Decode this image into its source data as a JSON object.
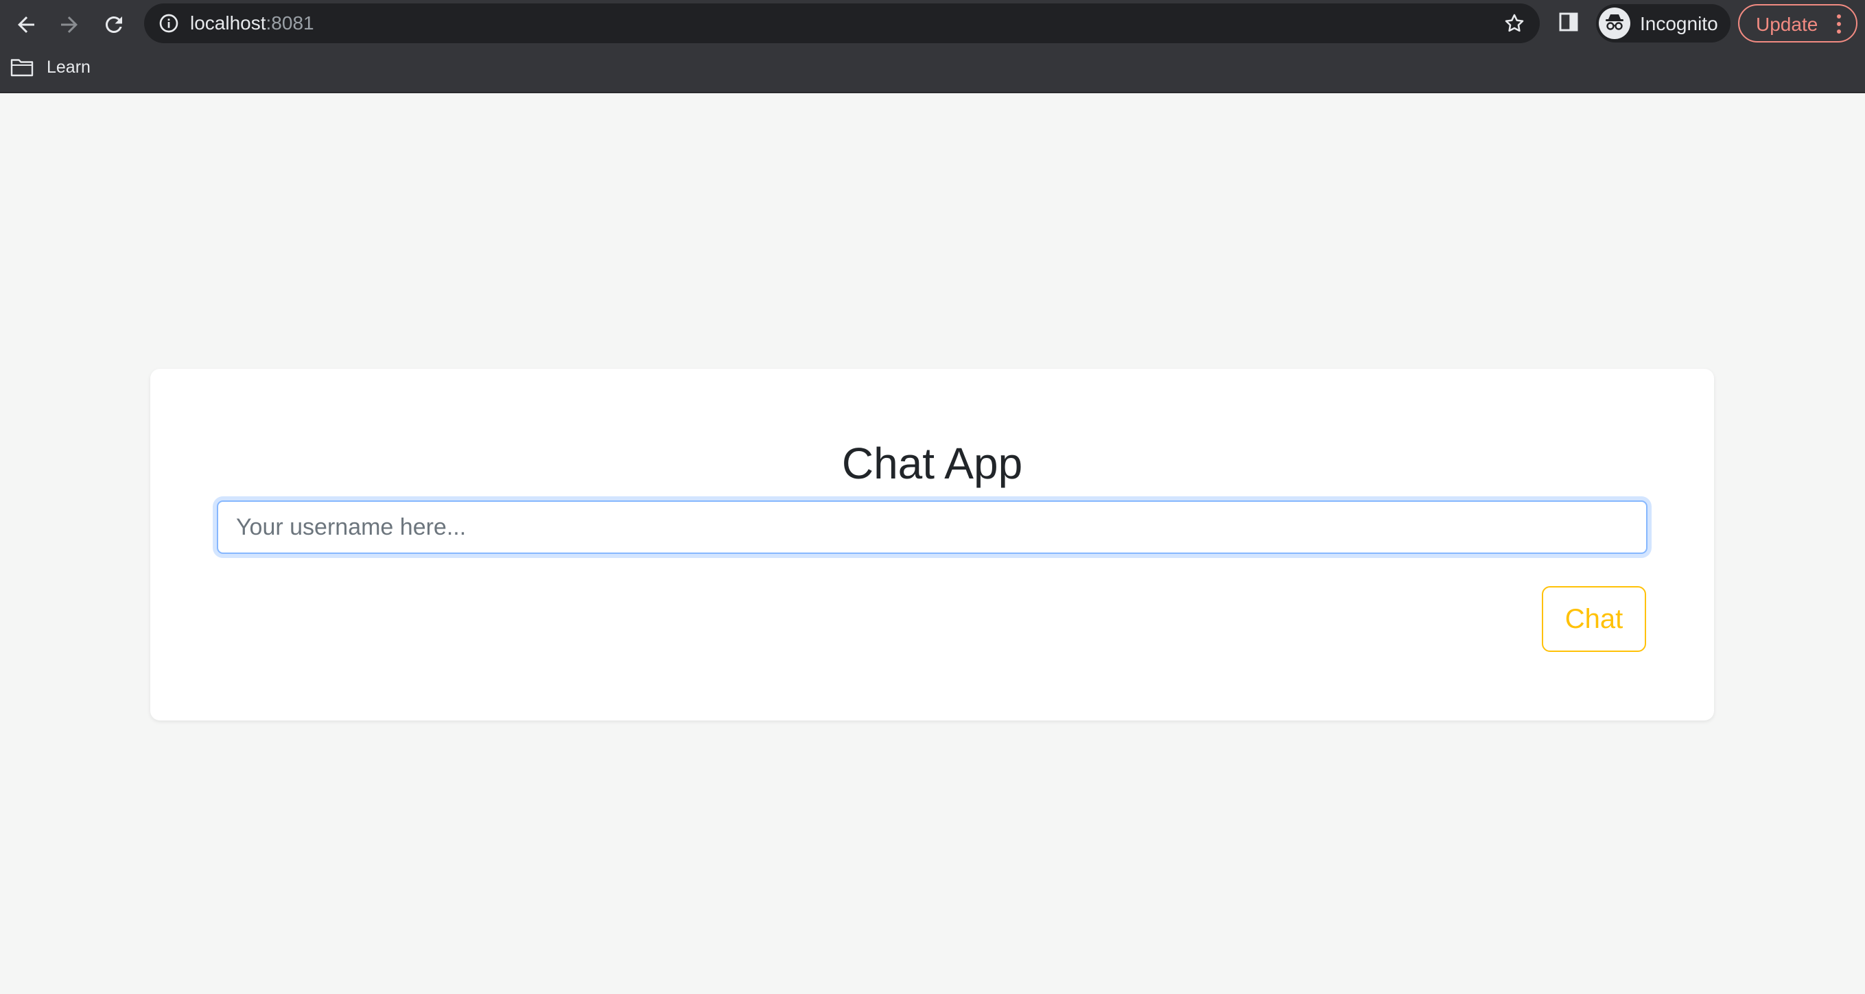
{
  "browser": {
    "url_host": "localhost",
    "url_port": ":8081",
    "profile_label": "Incognito",
    "update_label": "Update",
    "bookmarks": [
      {
        "label": "Learn"
      }
    ],
    "icons": [
      "back-icon",
      "forward-icon",
      "reload-icon",
      "info-icon",
      "star-icon",
      "side-panel-icon",
      "incognito-icon",
      "more-vert-icon",
      "folder-icon"
    ]
  },
  "page": {
    "title": "Chat App",
    "username_input": {
      "placeholder": "Your username here...",
      "value": ""
    },
    "chat_button_label": "Chat"
  },
  "colors": {
    "chrome_bg": "#35363a",
    "omnibox_bg": "#202124",
    "page_bg": "#f5f6f5",
    "card_bg": "#ffffff",
    "update_accent": "#f28b82",
    "input_focus": "#86b7fe",
    "chat_button_accent": "#ffc107"
  }
}
